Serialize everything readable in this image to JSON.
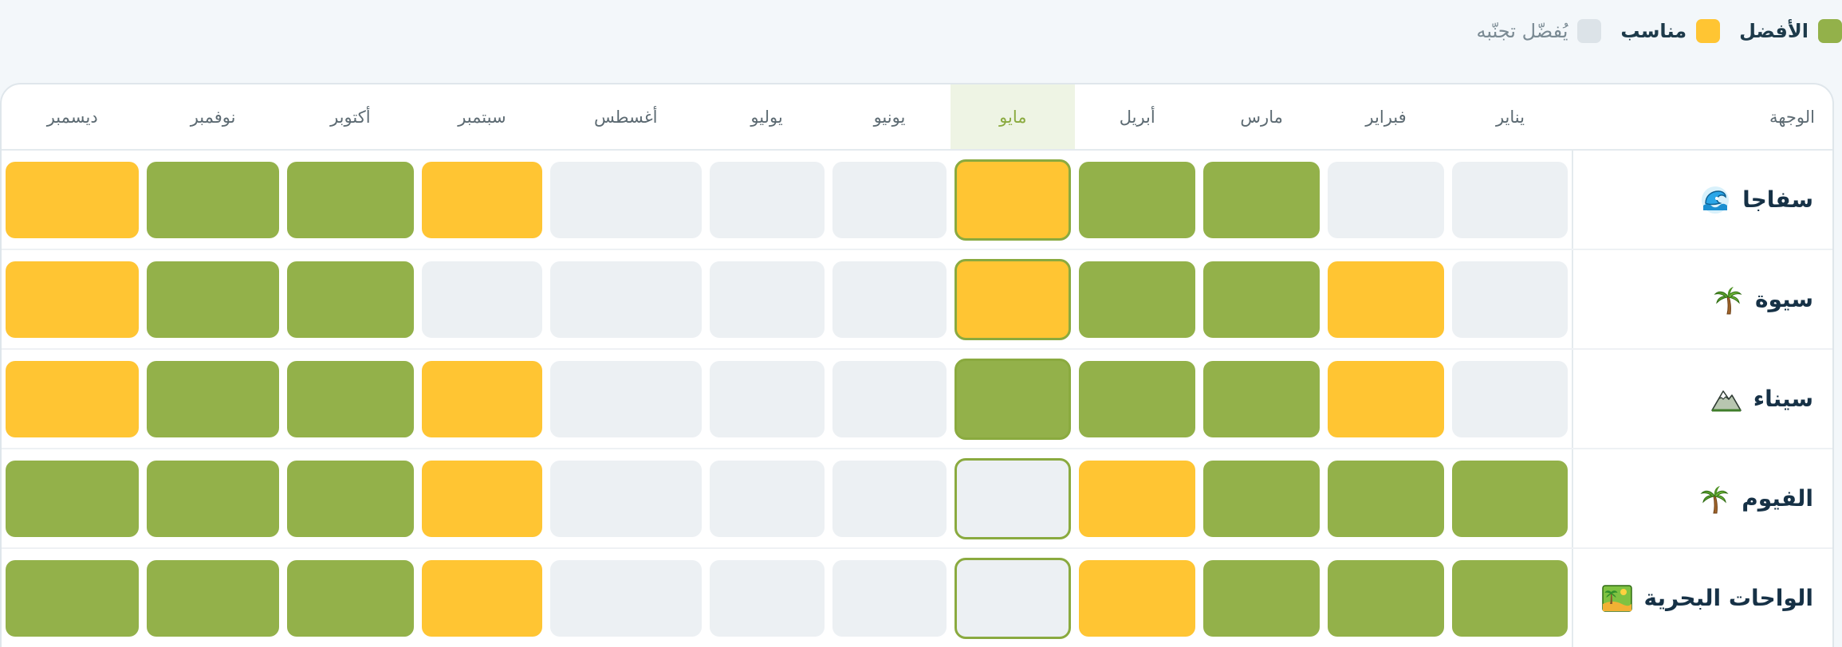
{
  "legend": [
    {
      "key": "best",
      "label": "الأفضل",
      "color": "#93b14a"
    },
    {
      "key": "good",
      "label": "مناسب",
      "color": "#ffc533"
    },
    {
      "key": "avoid",
      "label": "يُفضّل تجنّبه",
      "color": "#dce3e8"
    }
  ],
  "table": {
    "destination_header": "الوجهة",
    "current_month_index": 4,
    "months": [
      "يناير",
      "فبراير",
      "مارس",
      "أبريل",
      "مايو",
      "يونيو",
      "يوليو",
      "أغسطس",
      "سبتمبر",
      "أكتوبر",
      "نوفمبر",
      "ديسمبر"
    ],
    "rows": [
      {
        "name": "سفاجا",
        "icon": "wave-icon",
        "ratings": [
          "avoid",
          "avoid",
          "best",
          "best",
          "good",
          "avoid",
          "avoid",
          "avoid",
          "good",
          "best",
          "best",
          "good"
        ]
      },
      {
        "name": "سيوة",
        "icon": "palm-tree-icon",
        "ratings": [
          "avoid",
          "good",
          "best",
          "best",
          "good",
          "avoid",
          "avoid",
          "avoid",
          "avoid",
          "best",
          "best",
          "good"
        ]
      },
      {
        "name": "سيناء",
        "icon": "mountain-icon",
        "ratings": [
          "avoid",
          "good",
          "best",
          "best",
          "best",
          "avoid",
          "avoid",
          "avoid",
          "good",
          "best",
          "best",
          "good"
        ]
      },
      {
        "name": "الفيوم",
        "icon": "palm-tree-icon",
        "ratings": [
          "best",
          "best",
          "best",
          "good",
          "avoid",
          "avoid",
          "avoid",
          "avoid",
          "good",
          "best",
          "best",
          "best"
        ]
      },
      {
        "name": "الواحات البحرية",
        "icon": "oasis-icon",
        "ratings": [
          "best",
          "best",
          "best",
          "good",
          "avoid",
          "avoid",
          "avoid",
          "avoid",
          "good",
          "best",
          "best",
          "best"
        ]
      }
    ]
  }
}
